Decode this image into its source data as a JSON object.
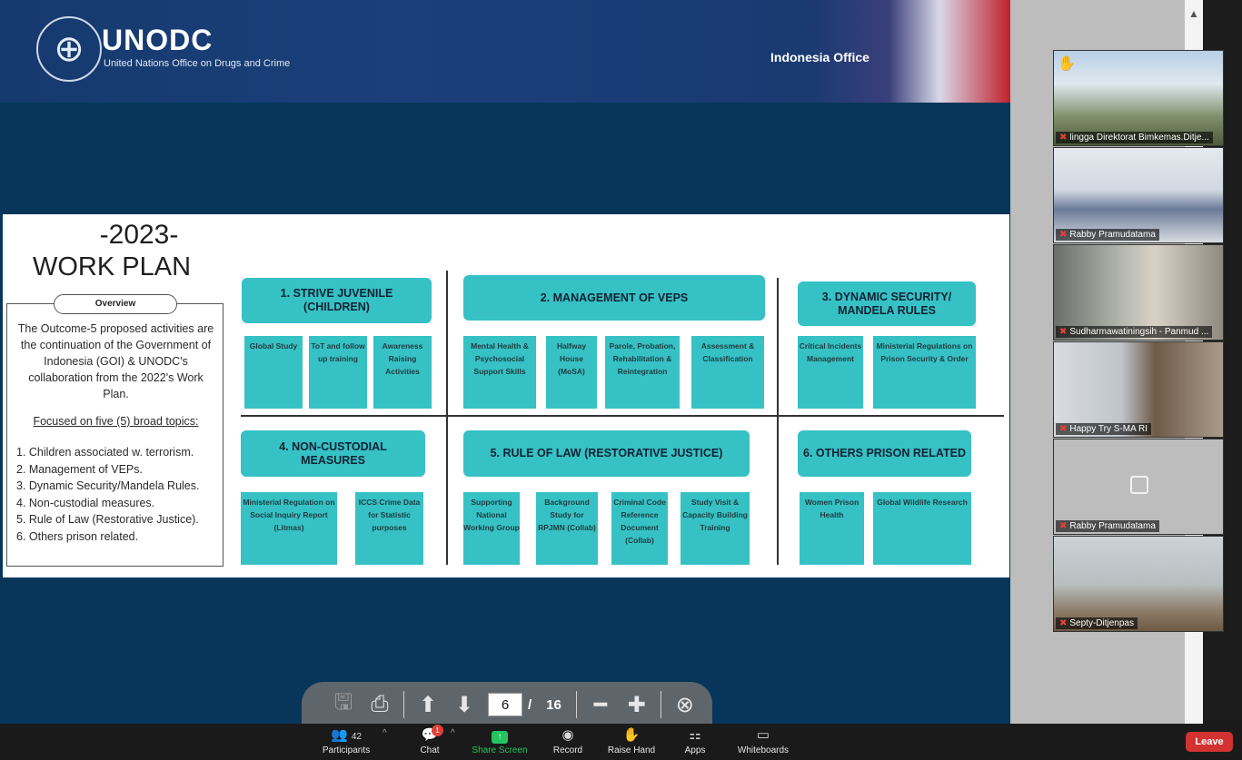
{
  "slide": {
    "org_name": "UNODC",
    "org_full": "United Nations Office on Drugs and Crime",
    "office": "Indonesia Office",
    "year": "-2023-",
    "title": "WORK PLAN",
    "overview_label": "Overview",
    "overview_text": "The Outcome-5 proposed activities are the continuation of the Government of Indonesia (GOI) & UNODC's collaboration from the 2022's Work Plan.",
    "focus_text": "Focused on five (5) broad topics:",
    "topics_list": [
      "1. Children associated w. terrorism.",
      "2. Management of VEPs.",
      "3. Dynamic Security/Mandela Rules.",
      "4. Non-custodial measures.",
      "5. Rule of Law (Restorative Justice).",
      "6. Others prison related."
    ],
    "topics": [
      {
        "title": "1. STRIVE JUVENILE (CHILDREN)",
        "subs": [
          "Global Study",
          "ToT and follow up training",
          "Awareness Raising Activities"
        ]
      },
      {
        "title": "2. MANAGEMENT OF VEPS",
        "subs": [
          "Mental Health & Psychosocial Support Skills",
          "Halfway House (MoSA)",
          "Parole, Probation, Rehabilitation & Reintegration",
          "Assessment & Classification"
        ]
      },
      {
        "title": "3. DYNAMIC SECURITY/ MANDELA RULES",
        "subs": [
          "Critical Incidents Management",
          "Ministerial Regulations on Prison Security & Order"
        ]
      },
      {
        "title": "4. NON-CUSTODIAL MEASURES",
        "subs": [
          "Ministerial Regulation on Social Inquiry Report (Litmas)",
          "ICCS Crime Data for Statistic purposes"
        ]
      },
      {
        "title": "5. RULE OF LAW (RESTORATIVE JUSTICE)",
        "subs": [
          "Supporting National Working Group",
          "Background Study for RPJMN (Collab)",
          "Criminal Code Reference Document (Collab)",
          "Study Visit & Capacity Building Training"
        ]
      },
      {
        "title": "6. OTHERS PRISON RELATED",
        "subs": [
          "Women Prison Health",
          "Global Wildlife Research"
        ]
      }
    ],
    "accent_color": "#36c1c5"
  },
  "pdf_toolbar": {
    "current_page": "6",
    "page_sep": "/",
    "total_pages": "16",
    "icons": [
      "save-icon",
      "print-icon",
      "arrow-up-icon",
      "arrow-down-icon",
      "zoom-out-icon",
      "zoom-in-icon",
      "close-icon"
    ]
  },
  "participants_tiles": [
    {
      "name": "lingga Direktorat Bimkemas.Ditje...",
      "muted": true,
      "hand_raised": true
    },
    {
      "name": "Rabby Pramudatama",
      "muted": true
    },
    {
      "name": "Sudharmawatiningsih - Panmud ...",
      "muted": true
    },
    {
      "name": "Happy Try S-MA RI",
      "muted": true
    },
    {
      "name": "Rabby Pramudatama",
      "muted": true,
      "video_off": true
    },
    {
      "name": "Septy-Ditjenpas",
      "muted": true
    }
  ],
  "bottom_bar": {
    "participants_label": "Participants",
    "participants_count": "42",
    "chat_label": "Chat",
    "chat_badge": "1",
    "share_label": "Share Screen",
    "record_label": "Record",
    "raise_hand_label": "Raise Hand",
    "apps_label": "Apps",
    "whiteboards_label": "Whiteboards",
    "leave_label": "Leave",
    "share_color": "#22c55e",
    "leave_color": "#d23330"
  }
}
